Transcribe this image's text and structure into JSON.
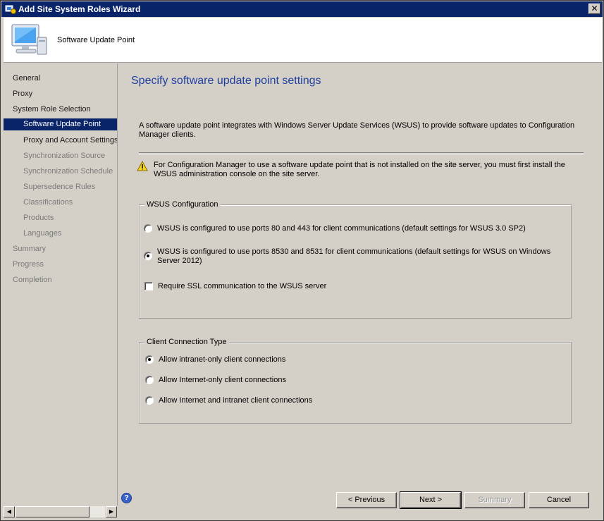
{
  "window": {
    "title": "Add Site System Roles Wizard",
    "close_glyph": "✕",
    "icon": "wizard-app-icon"
  },
  "header": {
    "title": "Software Update Point",
    "icon": "computer-monitor-icon"
  },
  "nav": {
    "items": [
      {
        "label": "General",
        "level": 0,
        "state": "normal"
      },
      {
        "label": "Proxy",
        "level": 0,
        "state": "normal"
      },
      {
        "label": "System Role Selection",
        "level": 0,
        "state": "normal"
      },
      {
        "label": "Software Update Point",
        "level": 1,
        "state": "selected"
      },
      {
        "label": "Proxy and Account Settings",
        "level": 1,
        "state": "normal"
      },
      {
        "label": "Synchronization Source",
        "level": 1,
        "state": "dim"
      },
      {
        "label": "Synchronization Schedule",
        "level": 1,
        "state": "dim"
      },
      {
        "label": "Supersedence Rules",
        "level": 1,
        "state": "dim"
      },
      {
        "label": "Classifications",
        "level": 1,
        "state": "dim"
      },
      {
        "label": "Products",
        "level": 1,
        "state": "dim"
      },
      {
        "label": "Languages",
        "level": 1,
        "state": "dim"
      },
      {
        "label": "Summary",
        "level": 0,
        "state": "dim"
      },
      {
        "label": "Progress",
        "level": 0,
        "state": "dim"
      },
      {
        "label": "Completion",
        "level": 0,
        "state": "dim"
      }
    ],
    "scroll_left_glyph": "◀",
    "scroll_right_glyph": "▶"
  },
  "main": {
    "heading": "Specify software update point settings",
    "intro": "A software update point integrates with Windows Server Update Services (WSUS) to provide software updates to Configuration Manager clients.",
    "warning": "For Configuration Manager to use a software update point that is not installed on the site server, you must first install the WSUS administration console on the site server.",
    "wsus_group": {
      "legend": "WSUS Configuration",
      "option1": "WSUS is configured to use ports 80 and 443 for client communications (default settings for WSUS 3.0 SP2)",
      "option2": "WSUS is configured to use ports 8530 and 8531 for client communications (default settings for WSUS on Windows Server 2012)",
      "selected": "option2",
      "ssl_label": "Require SSL communication to the WSUS server",
      "ssl_checked": false
    },
    "client_group": {
      "legend": "Client Connection Type",
      "option1": "Allow intranet-only client connections",
      "option2": "Allow Internet-only client connections",
      "option3": "Allow Internet and intranet client connections",
      "selected": "option1"
    }
  },
  "buttons": {
    "help_glyph": "?",
    "previous": "< Previous",
    "next": "Next >",
    "summary": "Summary",
    "cancel": "Cancel"
  },
  "colors": {
    "titlebar": "#0a246a",
    "selection": "#0a246a",
    "heading": "#1e3fa0",
    "face": "#d4d0c8"
  }
}
